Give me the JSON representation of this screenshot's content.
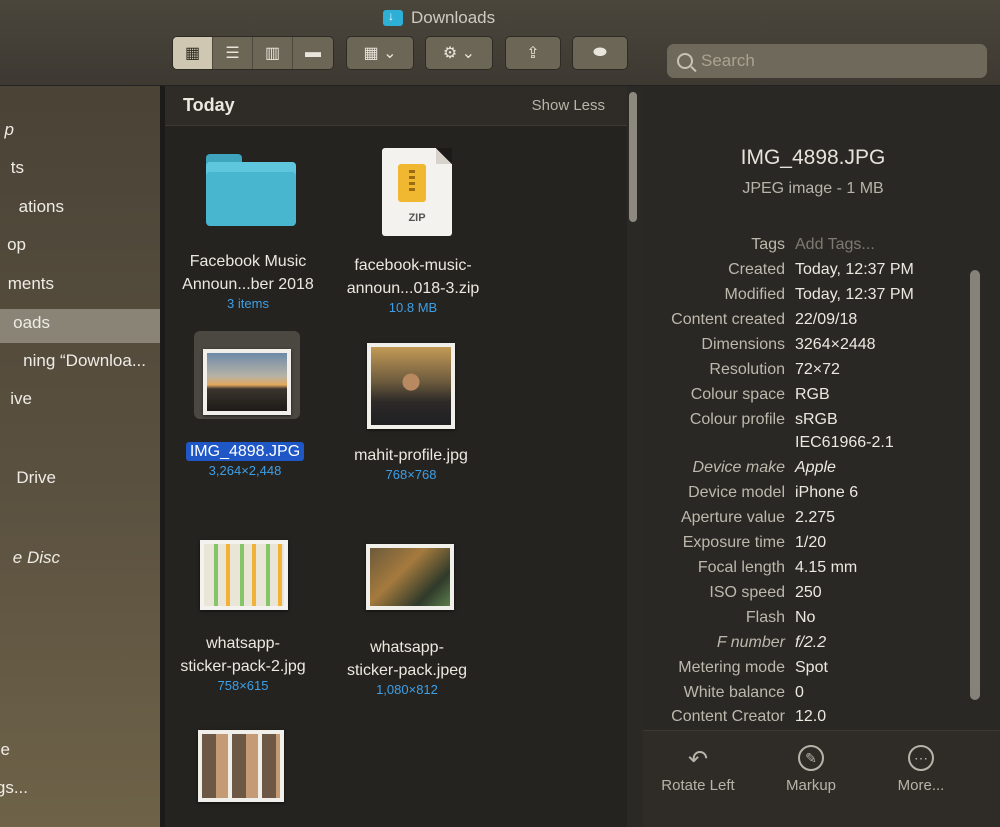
{
  "window": {
    "title": "Downloads"
  },
  "toolbar": {
    "view_icons": [
      "icon-view-icon",
      "list-view-icon",
      "column-view-icon",
      "gallery-view-icon"
    ],
    "group_icon": "grid-menu-icon",
    "action_icon": "gear-icon",
    "share_icon": "share-icon",
    "tag_icon": "tag-icon"
  },
  "search": {
    "placeholder": "Search"
  },
  "sidebar": {
    "items": [
      {
        "label": "p"
      },
      {
        "label": "ts"
      },
      {
        "label": "ations"
      },
      {
        "label": "op"
      },
      {
        "label": "ments"
      },
      {
        "label": "oads"
      },
      {
        "label": "ning “Downloa..."
      },
      {
        "label": "ive"
      },
      {
        "label": " Drive"
      },
      {
        "label": "e Disc"
      },
      {
        "label": "e"
      },
      {
        "label": "gs..."
      }
    ]
  },
  "files": {
    "section_title": "Today",
    "show_less": "Show Less",
    "items": [
      {
        "name_1": "Facebook Music",
        "name_2": "Announ...ber 2018",
        "meta": "3 items"
      },
      {
        "name_1": "facebook-music-",
        "name_2": "announ...018-3.zip",
        "meta": "10.8 MB",
        "badge": "ZIP"
      },
      {
        "name_1": "IMG_4898.JPG",
        "meta": "3,264×2,448"
      },
      {
        "name_1": "mahit-profile.jpg",
        "meta": "768×768"
      },
      {
        "name_1": "whatsapp-",
        "name_2": "sticker-pack-2.jpg",
        "meta": "758×615"
      },
      {
        "name_1": "whatsapp-",
        "name_2": "sticker-pack.jpeg",
        "meta": "1,080×812"
      }
    ]
  },
  "info": {
    "name": "IMG_4898.JPG",
    "kind": "JPEG image - 1 MB",
    "rows": [
      {
        "k": "Tags",
        "v": "Add Tags..."
      },
      {
        "k": "Created",
        "v": "Today, 12:37 PM"
      },
      {
        "k": "Modified",
        "v": "Today, 12:37 PM"
      },
      {
        "k": "Content created",
        "v": "22/09/18"
      },
      {
        "k": "Dimensions",
        "v": "3264×2448"
      },
      {
        "k": "Resolution",
        "v": "72×72"
      },
      {
        "k": "Colour space",
        "v": "RGB"
      },
      {
        "k": "Colour profile",
        "v": "sRGB"
      },
      {
        "k": "",
        "v": "IEC61966-2.1"
      },
      {
        "k": "Device make",
        "v": "Apple"
      },
      {
        "k": "Device model",
        "v": "iPhone 6"
      },
      {
        "k": "Aperture value",
        "v": "2.275"
      },
      {
        "k": "Exposure time",
        "v": "1/20"
      },
      {
        "k": "Focal length",
        "v": "4.15 mm"
      },
      {
        "k": "ISO speed",
        "v": "250"
      },
      {
        "k": "Flash",
        "v": "No"
      },
      {
        "k": "F number",
        "v": "f/2.2"
      },
      {
        "k": "Metering mode",
        "v": "Spot"
      },
      {
        "k": "White balance",
        "v": "0"
      },
      {
        "k": "Content Creator",
        "v": "12.0"
      }
    ]
  },
  "actions": {
    "rotate_left": "Rotate Left",
    "markup": "Markup",
    "more": "More..."
  },
  "colors": {
    "selection": "#1f57c7",
    "meta_text": "#3d9fe6",
    "folder": "#49b6cf"
  }
}
